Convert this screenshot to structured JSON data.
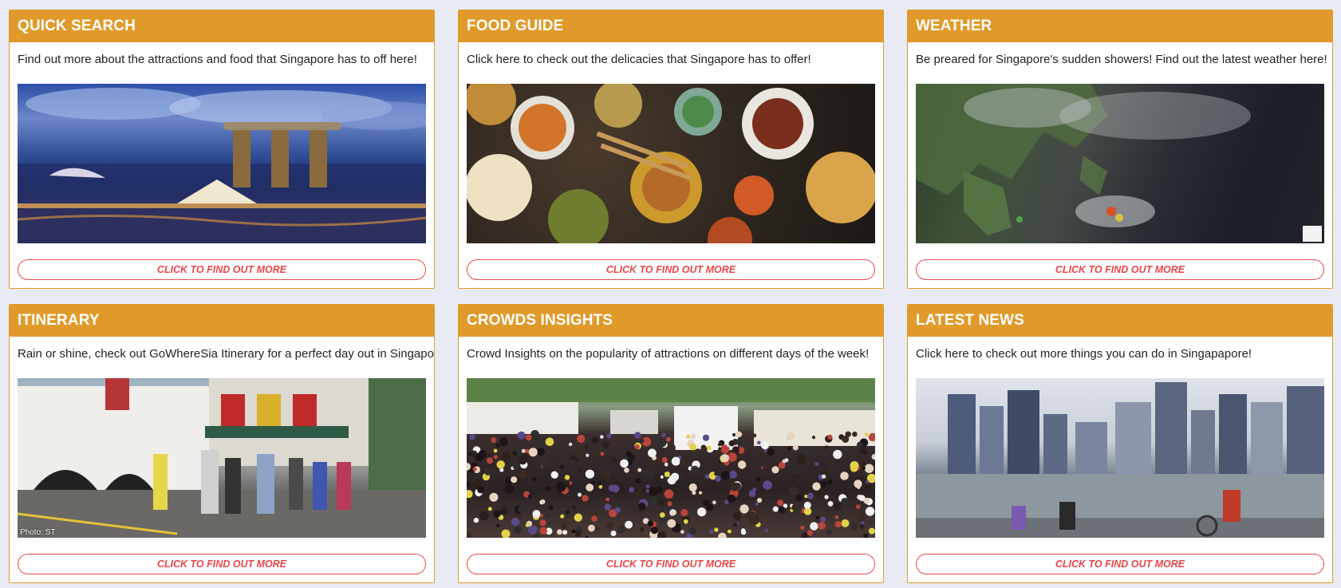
{
  "cards": [
    {
      "title": "QUICK SEARCH",
      "description": "Find out more about the attractions and food that Singapore has to off here!",
      "image": "marina-bay-sands-night-photo",
      "cta": "CLICK TO FIND OUT MORE"
    },
    {
      "title": "FOOD GUIDE",
      "description": "Click here to check out the delicacies that Singapore has to offer!",
      "image": "singapore-food-spread-photo",
      "cta": "CLICK TO FIND OUT MORE"
    },
    {
      "title": "WEATHER",
      "description": "Be preared for Singapore's sudden showers! Find out the latest weather here!",
      "image": "satellite-weather-map",
      "cta": "CLICK TO FIND OUT MORE"
    },
    {
      "title": "ITINERARY",
      "description": "Rain or shine, check out GoWhereSia Itinerary for a perfect day out in Singapore!",
      "image": "street-tourists-photo",
      "photo_credit": "Photo: ST",
      "cta": "CLICK TO FIND OUT MORE"
    },
    {
      "title": "CROWDS INSIGHTS",
      "description": "Crowd Insights on the popularity of attractions on different days of the week!",
      "image": "crowd-photo",
      "cta": "CLICK TO FIND OUT MORE"
    },
    {
      "title": "LATEST NEWS",
      "description": "Click here to check out more things you can do in Singapapore!",
      "image": "singapore-skyline-photo",
      "cta": "CLICK TO FIND OUT MORE"
    }
  ],
  "colors": {
    "page_background": "#e8ebf3",
    "card_header": "#e09a2a",
    "cta_text": "#e8464a",
    "cta_border": "#e84b4b"
  }
}
